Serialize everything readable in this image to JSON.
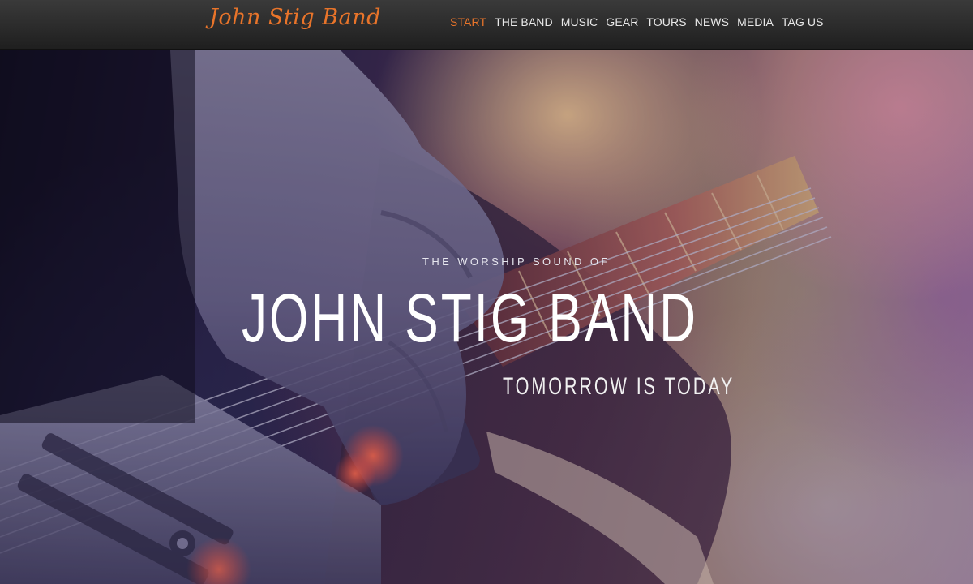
{
  "header": {
    "brand": "John Stig Band",
    "nav": [
      {
        "label": "START",
        "active": true
      },
      {
        "label": "THE BAND",
        "active": false
      },
      {
        "label": "MUSIC",
        "active": false
      },
      {
        "label": "GEAR",
        "active": false
      },
      {
        "label": "TOURS",
        "active": false
      },
      {
        "label": "NEWS",
        "active": false
      },
      {
        "label": "MEDIA",
        "active": false
      },
      {
        "label": "TAG US",
        "active": false
      }
    ]
  },
  "hero": {
    "kicker": "THE WORSHIP SOUND OF",
    "title": "JOHN STIG BAND",
    "tagline": "TOMORROW IS TODAY"
  },
  "colors": {
    "accent": "#e8742a",
    "nav_text": "#e9e9e9",
    "navbar_bg": "#2a2a2a"
  }
}
